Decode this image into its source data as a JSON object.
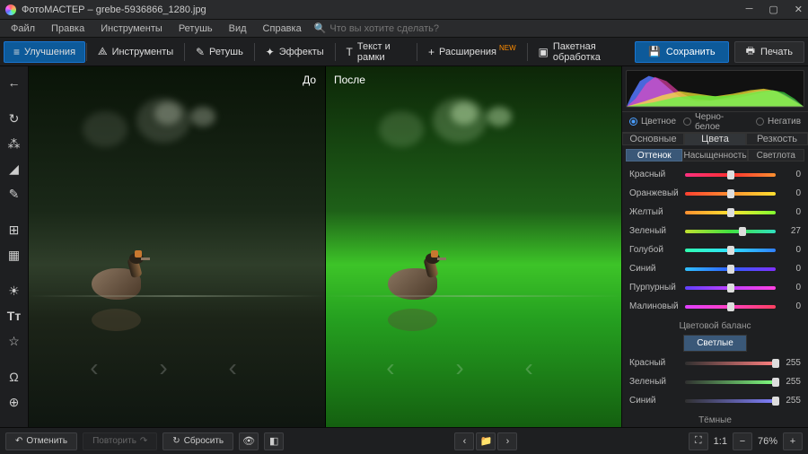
{
  "title": "ФотоМАСТЕР – grebe-5936866_1280.jpg",
  "menu": [
    "Файл",
    "Правка",
    "Инструменты",
    "Ретушь",
    "Вид",
    "Справка"
  ],
  "search_placeholder": "Что вы хотите сделать?",
  "toolbar": {
    "improve": "Улучшения",
    "tools": "Инструменты",
    "retouch": "Ретушь",
    "effects": "Эффекты",
    "text": "Текст и рамки",
    "ext": "Расширения",
    "ext_badge": "NEW",
    "batch": "Пакетная обработка",
    "save": "Сохранить",
    "print": "Печать"
  },
  "canvas": {
    "before": "До",
    "after": "После"
  },
  "modes": {
    "color": "Цветное",
    "bw": "Черно-белое",
    "neg": "Негатив"
  },
  "tabs": {
    "basic": "Основные",
    "colors": "Цвета",
    "sharp": "Резкость"
  },
  "subtabs": {
    "hue": "Оттенок",
    "sat": "Насыщенность",
    "lum": "Светлота"
  },
  "hue": [
    {
      "name": "Красный",
      "v": 0,
      "g": "linear-gradient(90deg,#ff3080,#ff3030,#ff9030)"
    },
    {
      "name": "Оранжевый",
      "v": 0,
      "g": "linear-gradient(90deg,#ff4030,#ff9030,#ffe030)"
    },
    {
      "name": "Желтый",
      "v": 0,
      "g": "linear-gradient(90deg,#ff9030,#ffe030,#80ff30)"
    },
    {
      "name": "Зеленый",
      "v": 27,
      "g": "linear-gradient(90deg,#c0e030,#40e040,#30e0c0)"
    },
    {
      "name": "Голубой",
      "v": 0,
      "g": "linear-gradient(90deg,#30ffb0,#30e0ff,#3080ff)"
    },
    {
      "name": "Синий",
      "v": 0,
      "g": "linear-gradient(90deg,#30c0ff,#3060ff,#8030ff)"
    },
    {
      "name": "Пурпурный",
      "v": 0,
      "g": "linear-gradient(90deg,#6040ff,#c040ff,#ff40e0)"
    },
    {
      "name": "Малиновый",
      "v": 0,
      "g": "linear-gradient(90deg,#e040ff,#ff40c0,#ff4060)"
    }
  ],
  "balance_title": "Цветовой баланс",
  "balance_tab_light": "Светлые",
  "balance_tab_dark": "Тёмные",
  "balance": [
    {
      "name": "Красный",
      "v": 255,
      "g": "linear-gradient(90deg,#303030,#ff8080)"
    },
    {
      "name": "Зеленый",
      "v": 255,
      "g": "linear-gradient(90deg,#303030,#80ff80)"
    },
    {
      "name": "Синий",
      "v": 255,
      "g": "linear-gradient(90deg,#303030,#8080ff)"
    }
  ],
  "bottom": {
    "undo": "Отменить",
    "redo": "Повторить",
    "reset": "Сбросить",
    "zoom_ratio": "1:1",
    "zoom_pct": "76%"
  }
}
